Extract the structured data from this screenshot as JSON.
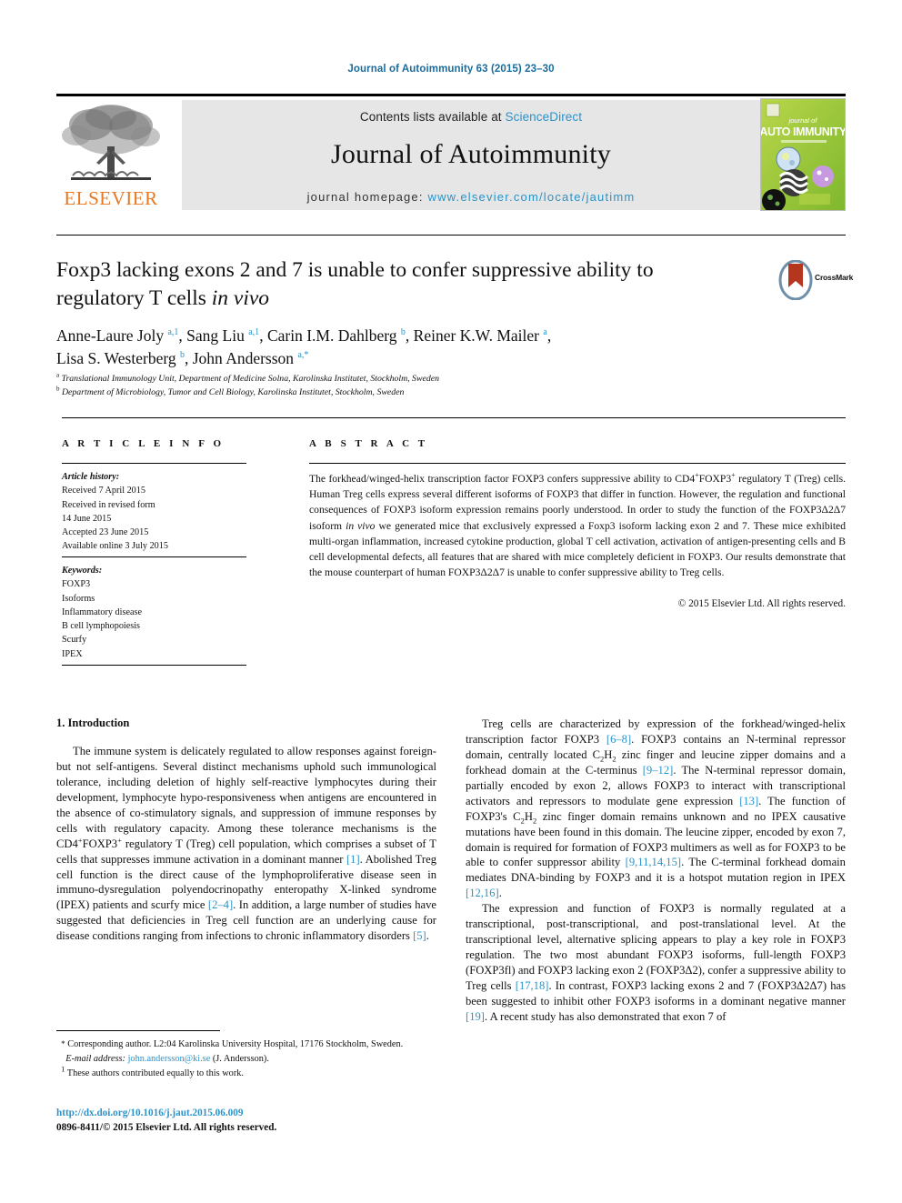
{
  "running_head": "Journal of Autoimmunity 63 (2015) 23–30",
  "masthead": {
    "contents_prefix": "Contents lists available at ",
    "sciencedirect": "ScienceDirect",
    "journal_title": "Journal of Autoimmunity",
    "homepage_label": "journal homepage: ",
    "homepage_url": "www.elsevier.com/locate/jautimm",
    "publisher": "ELSEVIER",
    "cover_line1": "journal of",
    "cover_line2": "AUTO IMMUNITY",
    "accent_link": "#2c93c8",
    "publisher_color": "#E87722",
    "banner_bg": "#e6e6e6"
  },
  "crossmark": {
    "label": "CrossMark"
  },
  "title": {
    "line1": "Foxp3 lacking exons 2 and 7 is unable to confer suppressive ability to",
    "line2_pre": "regulatory T cells ",
    "line2_italic": "in vivo"
  },
  "authors": {
    "list": "Anne-Laure Joly a,1, Sang Liu a,1, Carin I.M. Dahlberg b, Reiner K.W. Mailer a, Lisa S. Westerberg b, John Andersson a,*",
    "affiliation_a": "Translational Immunology Unit, Department of Medicine Solna, Karolinska Institutet, Stockholm, Sweden",
    "affiliation_b": "Department of Microbiology, Tumor and Cell Biology, Karolinska Institutet, Stockholm, Sweden"
  },
  "headings": {
    "article_info": "A R T I C L E  I N F O",
    "abstract": "A B S T R A C T",
    "introduction": "1. Introduction"
  },
  "article_history": {
    "label": "Article history:",
    "lines": [
      "Received 7 April 2015",
      "Received in revised form",
      "14 June 2015",
      "Accepted 23 June 2015",
      "Available online 3 July 2015"
    ]
  },
  "keywords": {
    "label": "Keywords:",
    "items": [
      "FOXP3",
      "Isoforms",
      "Inflammatory disease",
      "B cell lymphopoiesis",
      "Scurfy",
      "IPEX"
    ]
  },
  "abstract_text": {
    "body": "The forkhead/winged-helix transcription factor FOXP3 confers suppressive ability to CD4+FOXP3+ regulatory T (Treg) cells. Human Treg cells express several different isoforms of FOXP3 that differ in function. However, the regulation and functional consequences of FOXP3 isoform expression remains poorly understood. In order to study the function of the FOXP3Δ2Δ7 isoform in vivo we generated mice that exclusively expressed a Foxp3 isoform lacking exon 2 and 7. These mice exhibited multi-organ inflammation, increased cytokine production, global T cell activation, activation of antigen-presenting cells and B cell developmental defects, all features that are shared with mice completely deficient in FOXP3. Our results demonstrate that the mouse counterpart of human FOXP3Δ2Δ7 is unable to confer suppressive ability to Treg cells.",
    "copyright": "© 2015 Elsevier Ltd. All rights reserved."
  },
  "body_left": {
    "paragraph1": "The immune system is delicately regulated to allow responses against foreign- but not self-antigens. Several distinct mechanisms uphold such immunological tolerance, including deletion of highly self-reactive lymphocytes during their development, lymphocyte hypo-responsiveness when antigens are encountered in the absence of co-stimulatory signals, and suppression of immune responses by cells with regulatory capacity. Among these tolerance mechanisms is the CD4+FOXP3+ regulatory T (Treg) cell population, which comprises a subset of T cells that suppresses immune activation in a dominant manner [1]. Abolished Treg cell function is the direct cause of the lymphoproliferative disease seen in immunodysregulation polyendocrinopathy enteropathy X-linked syndrome (IPEX) patients and scurfy mice [2–4]. In addition, a large number of studies have suggested that deficiencies in Treg cell function are an underlying cause for disease conditions ranging from infections to chronic inflammatory disorders [5]."
  },
  "body_right": {
    "paragraph1": "Treg cells are characterized by expression of the forkhead/winged-helix transcription factor FOXP3 [6–8]. FOXP3 contains an N-terminal repressor domain, centrally located C2H2 zinc finger and leucine zipper domains and a forkhead domain at the C-terminus [9–12]. The N-terminal repressor domain, partially encoded by exon 2, allows FOXP3 to interact with transcriptional activators and repressors to modulate gene expression [13]. The function of FOXP3's C2H2 zinc finger domain remains unknown and no IPEX causative mutations have been found in this domain. The leucine zipper, encoded by exon 7, domain is required for formation of FOXP3 multimers as well as for FOXP3 to be able to confer suppressor ability [9,11,14,15]. The C-terminal forkhead domain mediates DNA-binding by FOXP3 and it is a hotspot mutation region in IPEX [12,16].",
    "paragraph2": "The expression and function of FOXP3 is normally regulated at a transcriptional, post-transcriptional, and post-translational level. At the transcriptional level, alternative splicing appears to play a key role in FOXP3 regulation. The two most abundant FOXP3 isoforms, full-length FOXP3 (FOXP3fl) and FOXP3 lacking exon 2 (FOXP3Δ2), confer a suppressive ability to Treg cells [17,18]. In contrast, FOXP3 lacking exons 2 and 7 (FOXP3Δ2Δ7) has been suggested to inhibit other FOXP3 isoforms in a dominant negative manner [19]. A recent study has also demonstrated that exon 7 of"
  },
  "footnotes": {
    "corresponding": "Corresponding author. L2:04 Karolinska University Hospital, 17176 Stockholm, Sweden.",
    "email_label": "E-mail address:",
    "email": "john.andersson@ki.se",
    "email_suffix": "(J. Andersson).",
    "equal_contrib": "These authors contributed equally to this work."
  },
  "doi_block": {
    "doi": "http://dx.doi.org/10.1016/j.jaut.2015.06.009",
    "issn_line": "0896-8411/© 2015 Elsevier Ltd. All rights reserved."
  }
}
